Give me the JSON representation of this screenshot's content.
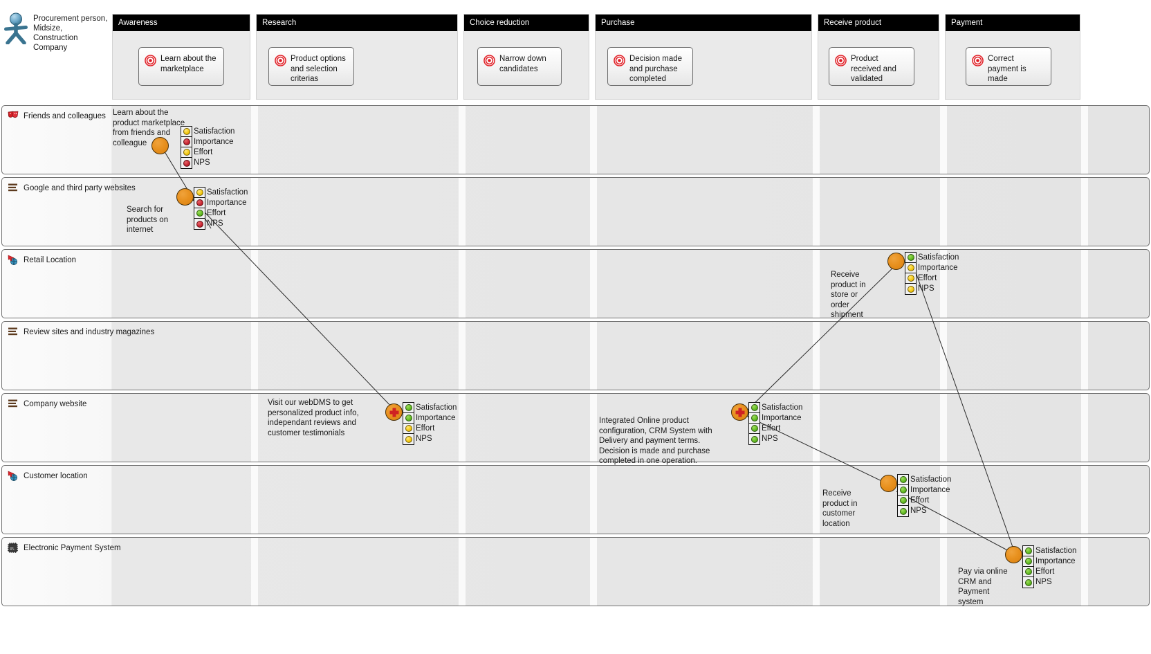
{
  "persona": {
    "label": "Procurement person, Midsize, Construction Company",
    "icon": "persona-actor-icon"
  },
  "phases": [
    {
      "key": "awareness",
      "title": "Awareness",
      "goal": "Learn about the marketplace"
    },
    {
      "key": "research",
      "title": "Research",
      "goal": "Product options and selection criterias"
    },
    {
      "key": "choice_reduction",
      "title": "Choice reduction",
      "goal": "Narrow down candidates"
    },
    {
      "key": "purchase",
      "title": "Purchase",
      "goal": "Decision made and purchase completed"
    },
    {
      "key": "receive_product",
      "title": "Receive product",
      "goal": "Product received and validated"
    },
    {
      "key": "payment",
      "title": "Payment",
      "goal": "Correct payment is made"
    }
  ],
  "metric_labels": [
    "Satisfaction",
    "Importance",
    "Effort",
    "NPS"
  ],
  "lanes": [
    {
      "key": "friends",
      "title": "Friends and colleagues",
      "icon": "theatre-masks-icon"
    },
    {
      "key": "google",
      "title": "Google and third party websites",
      "icon": "web-page-icon"
    },
    {
      "key": "retail",
      "title": "Retail Location",
      "icon": "location-globe-icon"
    },
    {
      "key": "review",
      "title": "Review sites and industry magazines",
      "icon": "web-page-icon"
    },
    {
      "key": "company",
      "title": "Company website",
      "icon": "web-page-icon"
    },
    {
      "key": "customer",
      "title": "Customer location",
      "icon": "location-globe-icon"
    },
    {
      "key": "payment",
      "title": "Electronic Payment System",
      "icon": "microchip-icon"
    }
  ],
  "touchpoints": [
    {
      "id": "tp1",
      "lane": "friends",
      "phase": "awareness",
      "note": "Learn about the product marketplace from friends and colleague",
      "marker": "plain",
      "metrics": [
        "yellow",
        "red",
        "yellow",
        "red"
      ]
    },
    {
      "id": "tp2",
      "lane": "google",
      "phase": "awareness",
      "note": "Search for products on internet",
      "marker": "plain",
      "metrics": [
        "yellow",
        "red",
        "green",
        "red"
      ]
    },
    {
      "id": "tp3",
      "lane": "company",
      "phase": "research",
      "note": "Visit our webDMS to get personalized product info, independant reviews and customer testimonials",
      "marker": "system",
      "metrics": [
        "green",
        "green",
        "yellow",
        "yellow"
      ]
    },
    {
      "id": "tp4",
      "lane": "company",
      "phase": "purchase",
      "note": "Integrated Online product configuration, CRM System with Delivery and payment terms. Decision is made and purchase completed in one operation.",
      "marker": "system",
      "metrics": [
        "green",
        "green",
        "green",
        "green"
      ]
    },
    {
      "id": "tp5",
      "lane": "retail",
      "phase": "receive_product",
      "note": "Receive product in store or order shipment",
      "marker": "plain",
      "metrics": [
        "green",
        "yellow",
        "yellow",
        "yellow"
      ]
    },
    {
      "id": "tp6",
      "lane": "customer",
      "phase": "receive_product",
      "note": "Receive product in customer location",
      "marker": "plain",
      "metrics": [
        "green",
        "green",
        "green",
        "green"
      ]
    },
    {
      "id": "tp7",
      "lane": "payment",
      "phase": "payment",
      "note": "Pay via online CRM and Payment system",
      "marker": "plain",
      "metrics": [
        "green",
        "green",
        "green",
        "green"
      ]
    }
  ],
  "colors": {
    "header_band": "#000000",
    "phase_fill": "#eaeaea",
    "touchpoint": "#e8911f",
    "good": "#5fb81f",
    "warn": "#f2c60c",
    "bad": "#c62430"
  }
}
